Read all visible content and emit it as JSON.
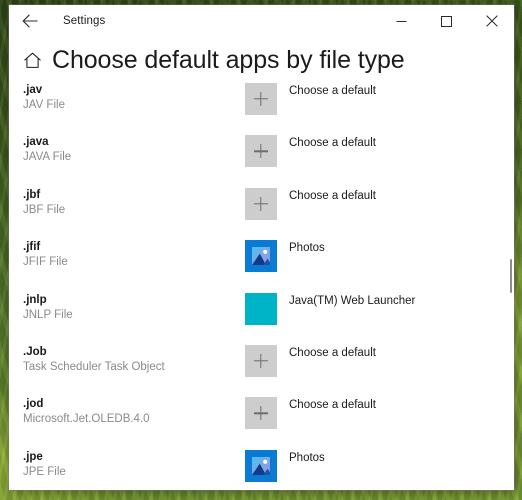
{
  "window": {
    "app_title": "Settings",
    "back_icon": "back-arrow-icon",
    "minimize_label": "minimize-icon",
    "maximize_label": "maximize-icon",
    "close_label": "close-icon"
  },
  "page": {
    "home_icon": "home-icon",
    "title": "Choose default apps by file type"
  },
  "colors": {
    "placeholder_tile": "#cdcdcd",
    "java_tile": "#00b4c8",
    "photos_tile": "#0a7bd4",
    "accent_text": "#1a1a1a",
    "muted_text": "#8a8a8a"
  },
  "list": {
    "rows": [
      {
        "extension": ".jav",
        "description": "JAV File",
        "app_label": "Choose a default",
        "tile_type": "placeholder",
        "icon": "plus-icon"
      },
      {
        "extension": ".java",
        "description": "JAVA File",
        "app_label": "Choose a default",
        "tile_type": "placeholder",
        "icon": "plus-icon"
      },
      {
        "extension": ".jbf",
        "description": "JBF File",
        "app_label": "Choose a default",
        "tile_type": "placeholder",
        "icon": "plus-icon"
      },
      {
        "extension": ".jfif",
        "description": "JFIF File",
        "app_label": "Photos",
        "tile_type": "photos",
        "icon": "photos-icon"
      },
      {
        "extension": ".jnlp",
        "description": "JNLP File",
        "app_label": "Java(TM) Web Launcher",
        "tile_type": "java",
        "icon": "java-launcher-icon"
      },
      {
        "extension": ".Job",
        "description": "Task Scheduler Task Object",
        "app_label": "Choose a default",
        "tile_type": "placeholder",
        "icon": "plus-icon"
      },
      {
        "extension": ".jod",
        "description": "Microsoft.Jet.OLEDB.4.0",
        "app_label": "Choose a default",
        "tile_type": "placeholder",
        "icon": "plus-icon"
      },
      {
        "extension": ".jpe",
        "description": "JPE File",
        "app_label": "Photos",
        "tile_type": "photos",
        "icon": "photos-icon"
      }
    ]
  }
}
